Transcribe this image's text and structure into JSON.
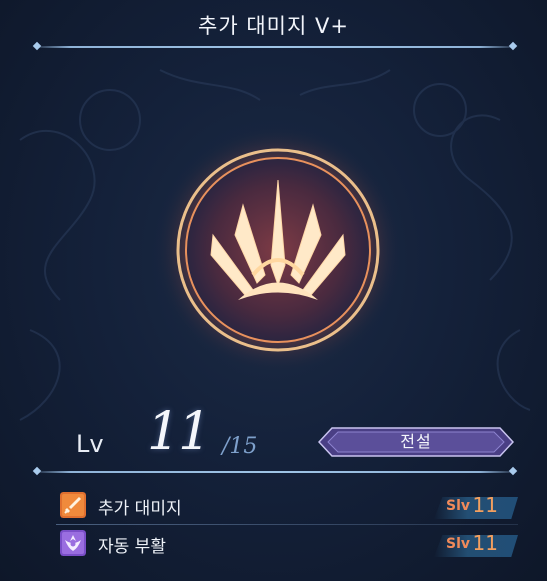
{
  "header": {
    "title": "추가 대미지 V+"
  },
  "level": {
    "label": "Lv",
    "value": "11",
    "max": "/15"
  },
  "rarity": {
    "label": "전설"
  },
  "skills": [
    {
      "name": "추가 대미지",
      "slv_label": "Slv",
      "slv_value": "11",
      "icon": "sword-icon"
    },
    {
      "name": "자동 부활",
      "slv_label": "Slv",
      "slv_value": "11",
      "icon": "revive-icon"
    }
  ],
  "colors": {
    "accent_orange": "#f29f5f",
    "rarity_purple": "#5b4f9a",
    "background": "#14213a"
  },
  "emblem": {
    "icon": "fire-emblem-icon"
  }
}
